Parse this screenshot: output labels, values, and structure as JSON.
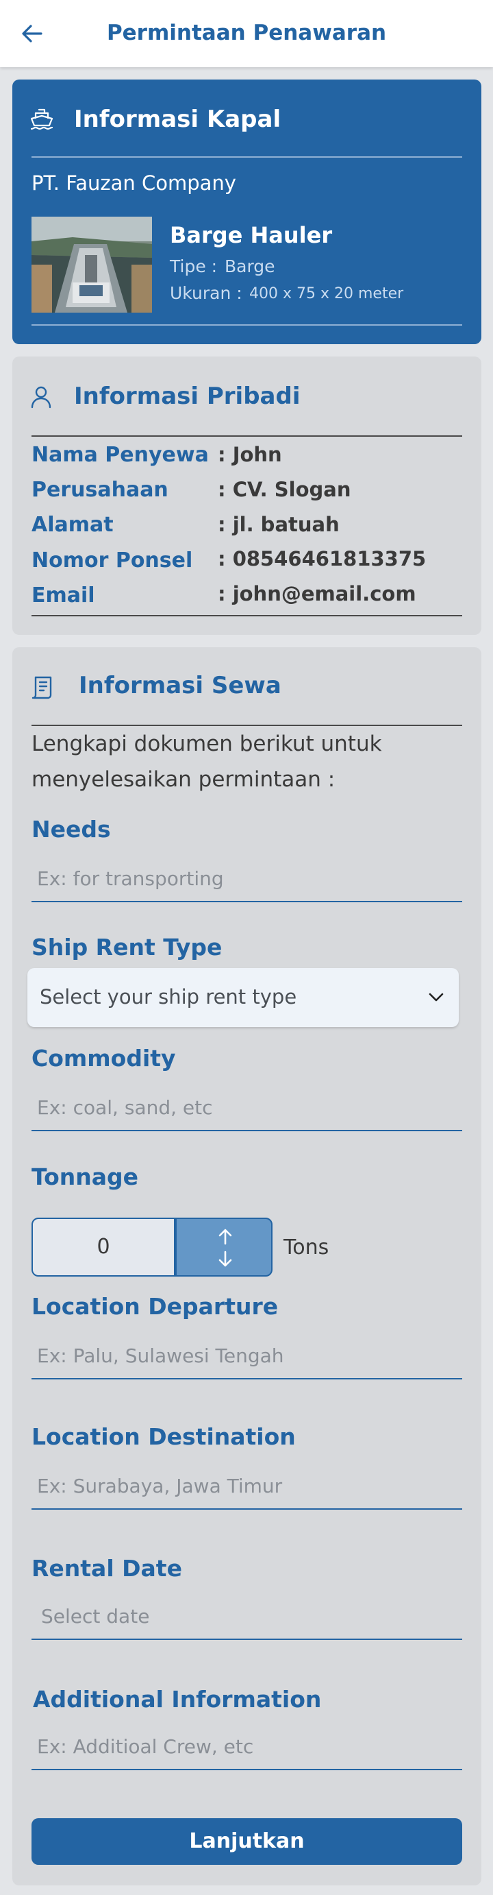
{
  "appbar": {
    "title": "Permintaan Penawaran",
    "back_icon": "arrow-left-icon"
  },
  "kapal": {
    "section_title": "Informasi Kapal",
    "icon": "ship-icon",
    "company": "PT. Fauzan Company",
    "ship_name": "Barge Hauler",
    "tipe_label": "Tipe :",
    "tipe_value": "Barge",
    "ukuran_label": "Ukuran :",
    "ukuran_value": "400 x 75 x 20 meter"
  },
  "pribadi": {
    "section_title": "Informasi Pribadi",
    "icon": "user-icon",
    "rows": [
      {
        "label": "Nama Penyewa",
        "value": ": John"
      },
      {
        "label": "Perusahaan",
        "value": ": CV. Slogan"
      },
      {
        "label": "Alamat",
        "value": ": jl. batuah"
      },
      {
        "label": "Nomor Ponsel",
        "value": ": 08546461813375"
      },
      {
        "label": "Email",
        "value": ": john@email.com"
      }
    ]
  },
  "sewa": {
    "section_title": "Informasi Sewa",
    "icon": "document-icon",
    "intro": "Lengkapi dokumen berikut untuk menyelesaikan permintaan :",
    "needs": {
      "label": "Needs",
      "placeholder": "Ex: for transporting"
    },
    "rent_type": {
      "label": "Ship Rent Type",
      "placeholder": "Select your ship rent type"
    },
    "commodity": {
      "label": "Commodity",
      "placeholder": "Ex: coal, sand, etc"
    },
    "tonnage": {
      "label": "Tonnage",
      "value": "0",
      "unit": "Tons"
    },
    "departure": {
      "label": "Location Departure",
      "placeholder": "Ex: Palu, Sulawesi Tengah"
    },
    "destination": {
      "label": "Location Destination",
      "placeholder": "Ex: Surabaya, Jawa Timur"
    },
    "rental_date": {
      "label": "Rental Date",
      "placeholder": "Select date"
    },
    "additional": {
      "label": "Additional Information",
      "placeholder": "Ex: Additioal Crew, etc"
    },
    "submit_label": "Lanjutkan"
  },
  "colors": {
    "primary": "#2364a3",
    "card_bg": "#d7d9dc",
    "page_bg": "#e3e5e8"
  }
}
